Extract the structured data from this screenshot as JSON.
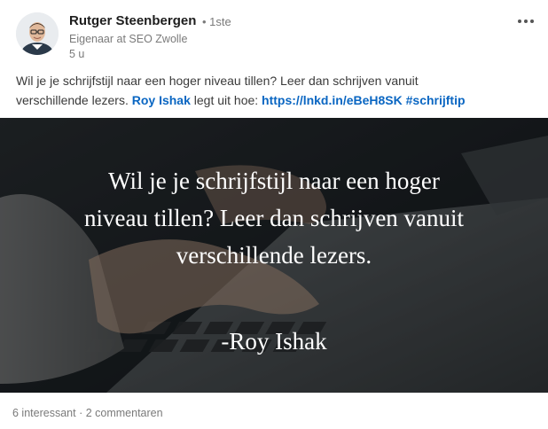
{
  "post": {
    "author": {
      "name": "Rutger Steenbergen",
      "degree": "• 1ste",
      "headline": "Eigenaar at SEO Zwolle",
      "timestamp": "5 u"
    },
    "text": {
      "line1": "Wil je je schrijfstijl naar een hoger niveau tillen? Leer dan schrijven vanuit",
      "line2_before": "verschillende lezers. ",
      "mention": "Roy Ishak",
      "line2_middle": " legt uit hoe: ",
      "link": "https://lnkd.in/eBeH8SK",
      "hashtag": "#schrijftip"
    },
    "image": {
      "quote_lines": [
        "Wil je je schrijfstijl naar een hoger",
        "niveau tillen? Leer dan schrijven vanuit",
        "verschillende lezers."
      ],
      "attribution": "-Roy Ishak"
    },
    "social": {
      "reactions": "6 interessant",
      "separator": "·",
      "comments": "2 commentaren"
    }
  },
  "icons": {
    "more": "more-options-icon",
    "avatar": "profile-photo"
  },
  "colors": {
    "link": "#0a66c2",
    "secondary_text": "#7a7a7a"
  }
}
